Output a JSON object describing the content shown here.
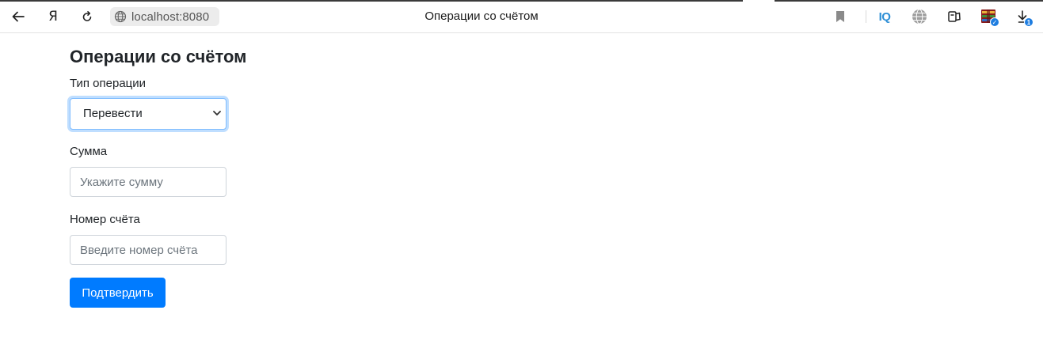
{
  "browser": {
    "address": "localhost:8080",
    "tab_title": "Операции со счётом",
    "back_icon": "arrow-left-icon",
    "yandex_icon": "yandex-logo-icon",
    "yandex_glyph": "Я",
    "reload_icon": "reload-icon",
    "site_info_icon": "globe-icon",
    "bookmark_icon": "bookmark-icon",
    "iq_label": "IQ",
    "translate_icon": "globe-icon",
    "collections_icon": "collections-icon",
    "extension_icon": "extension-icon",
    "downloads_icon": "download-icon",
    "downloads_badge": "1"
  },
  "page": {
    "title": "Операции со счётом",
    "operation_type": {
      "label": "Тип операции",
      "selected": "Перевести"
    },
    "amount": {
      "label": "Сумма",
      "placeholder": "Укажите сумму",
      "value": ""
    },
    "account": {
      "label": "Номер счёта",
      "placeholder": "Введите номер счёта",
      "value": ""
    },
    "submit_label": "Подтвердить"
  },
  "colors": {
    "primary": "#007bff",
    "focus_border": "#80bdff",
    "input_border": "#ced4da",
    "text": "#212529",
    "iq_blue": "#2e8fd6"
  }
}
